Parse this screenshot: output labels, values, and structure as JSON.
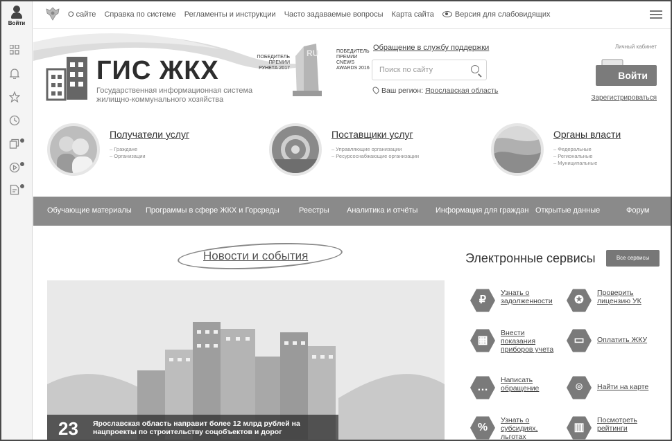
{
  "rail": {
    "login_label": "Войти",
    "icons": [
      "grid-icon",
      "bell-icon",
      "star-icon",
      "clock-icon",
      "copy-icon",
      "play-icon",
      "document-icon"
    ]
  },
  "topnav": {
    "items": [
      "О сайте",
      "Справка по системе",
      "Регламенты и инструкции",
      "Часто задаваемые вопросы",
      "Карта сайта"
    ],
    "accessibility": "Версия для слабовидящих"
  },
  "header": {
    "logo_title": "ГИС ЖКХ",
    "logo_subtitle_1": "Государственная информационная система",
    "logo_subtitle_2": "жилищно-коммунального хозяйства",
    "award1": [
      "ПОБЕДИТЕЛЬ",
      "ПРЕМИИ",
      "РУНЕТА 2017"
    ],
    "award2": [
      "ПОБЕДИТЕЛЬ",
      "ПРЕМИИ",
      "CNEWS",
      "AWARDS 2016"
    ],
    "support_link": "Обращение в службу поддержки",
    "search_placeholder": "Поиск по сайту",
    "region_label": "Ваш регион:",
    "region_value": "Ярославская область",
    "cabinet_label": "Личный кабинет",
    "login_button": "Войти",
    "register_link": "Зарегистрироваться"
  },
  "audiences": [
    {
      "title": "Получатели услуг",
      "subs": [
        "– Граждане",
        "– Организации"
      ]
    },
    {
      "title": "Поставщики услуг",
      "subs": [
        "– Управляющие организации",
        "– Ресурсоснабжающие организации"
      ]
    },
    {
      "title": "Органы власти",
      "subs": [
        "– Федеральные",
        "– Региональные",
        "– Муниципальные"
      ]
    }
  ],
  "mainnav": [
    "Обучающие материалы",
    "Программы в сфере ЖКХ и Горсреды",
    "Реестры",
    "Аналитика и отчёты",
    "Информация для граждан",
    "Открытые данные",
    "Форум"
  ],
  "news": {
    "title": "Новости и события",
    "day": "23",
    "headline": "Ярославская область направит более 12 млрд рублей на нацпроекты по строительству соцобъектов и дорог"
  },
  "services": {
    "title": "Электронные сервисы",
    "all_button": "Все сервисы",
    "items": [
      {
        "label": "Узнать о задолженности",
        "icon": "ruble-icon"
      },
      {
        "label": "Проверить лицензию УК",
        "icon": "badge-icon"
      },
      {
        "label": "Внести показания приборов учета",
        "icon": "meter-icon"
      },
      {
        "label": "Оплатить ЖКУ",
        "icon": "wallet-icon"
      },
      {
        "label": "Написать обращение",
        "icon": "chat-icon"
      },
      {
        "label": "Найти на карте",
        "icon": "map-pin-icon"
      },
      {
        "label": "Узнать о субсидиях, льготах",
        "icon": "percent-icon"
      },
      {
        "label": "Посмотреть рейтинги",
        "icon": "rating-icon"
      }
    ]
  }
}
